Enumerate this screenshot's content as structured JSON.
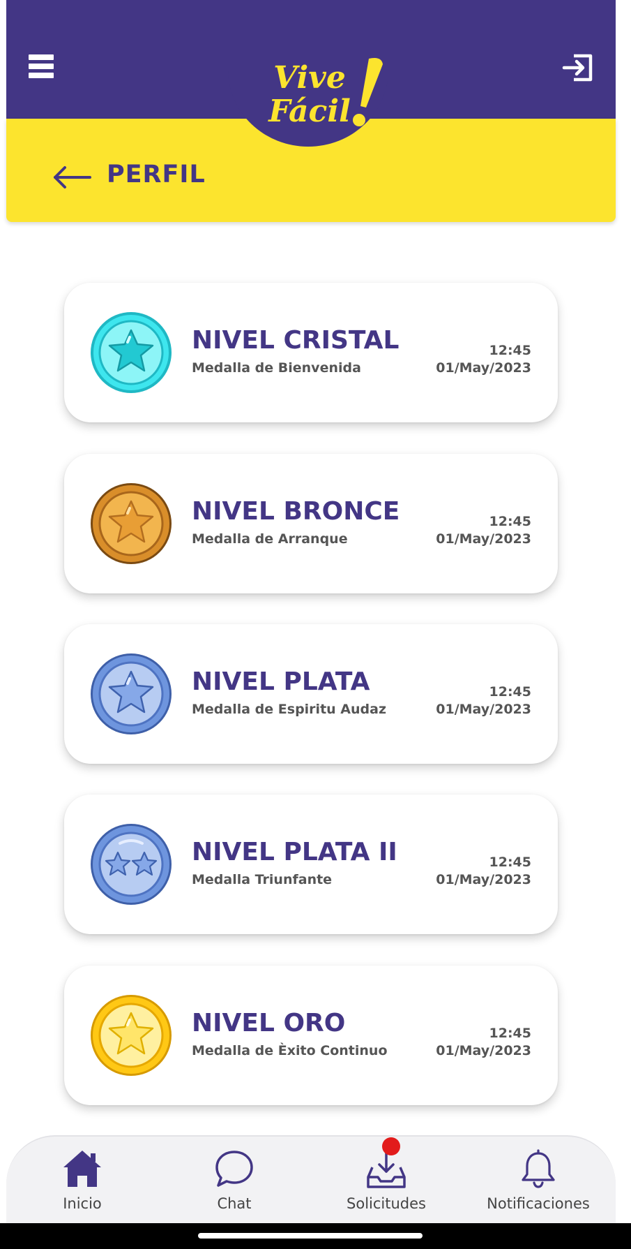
{
  "header": {
    "logo_line1": "Vive",
    "logo_line2": "Fácil",
    "page_title": "PERFIL"
  },
  "colors": {
    "primary": "#433685",
    "accent": "#FCE42E",
    "badge": "#E21B1B"
  },
  "medals": [
    {
      "title": "NIVEL CRISTAL",
      "subtitle": "Medalla de Bienvenida",
      "time": "12:45",
      "date": "01/May/2023",
      "icon": "crystal-medal-icon",
      "stars": 1
    },
    {
      "title": "NIVEL BRONCE",
      "subtitle": "Medalla de Arranque",
      "time": "12:45",
      "date": "01/May/2023",
      "icon": "bronze-medal-icon",
      "stars": 1
    },
    {
      "title": "NIVEL PLATA",
      "subtitle": "Medalla de Espiritu Audaz",
      "time": "12:45",
      "date": "01/May/2023",
      "icon": "silver-medal-icon",
      "stars": 1
    },
    {
      "title": "NIVEL PLATA II",
      "subtitle": "Medalla Triunfante",
      "time": "12:45",
      "date": "01/May/2023",
      "icon": "silver-two-star-medal-icon",
      "stars": 2
    },
    {
      "title": "NIVEL ORO",
      "subtitle": "Medalla de Èxito Continuo",
      "time": "12:45",
      "date": "01/May/2023",
      "icon": "gold-medal-icon",
      "stars": 1
    }
  ],
  "nav": {
    "items": [
      {
        "label": "Inicio",
        "icon": "home-icon"
      },
      {
        "label": "Chat",
        "icon": "chat-bubble-icon"
      },
      {
        "label": "Solicitudes",
        "icon": "inbox-download-icon"
      },
      {
        "label": "Notificaciones",
        "icon": "bell-icon"
      }
    ]
  }
}
